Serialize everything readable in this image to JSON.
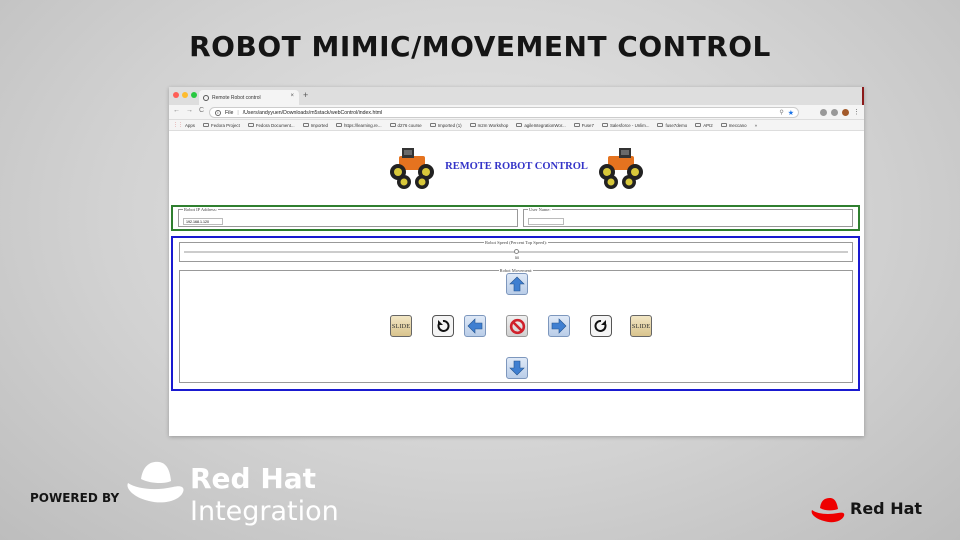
{
  "slide": {
    "title": "ROBOT MIMIC/MOVEMENT CONTROL",
    "powered_by": "POWERED BY",
    "integration_logo_line1": "Red Hat",
    "integration_logo_line2": "Integration",
    "redhat_logo": "Red Hat"
  },
  "browser": {
    "tab_title": "Remote Robot control",
    "tab_close": "×",
    "new_tab": "+",
    "url_prefix": "File",
    "url": "/Users/andyyuen/Downloads/m5stack/webControl/index.html",
    "bookmarks": [
      "Apps",
      "Fedora Project",
      "Fedora Document...",
      "Imported",
      "https://learning.re...",
      "d276 course",
      "Imported (1)",
      "m2m Workshop",
      "agileIntegrationWor...",
      "Fuse7",
      "Salesforce - Unlim...",
      "fuse7demo",
      "API2",
      "meccano"
    ],
    "bookmarks_more": "»"
  },
  "page": {
    "heading": "REMOTE ROBOT CONTROL",
    "ip_legend": "Robot IP Address:",
    "ip_value": "192.168.1.120",
    "user_legend": "User Name:",
    "user_value": "",
    "speed_legend": "Robot Speed (Percent Top Speed):",
    "speed_value": "50",
    "speed_fraction": 0.5,
    "movement_legend": "Robot Movement:",
    "slide_left_label": "SLIDE",
    "slide_right_label": "SLIDE"
  },
  "colors": {
    "green_border": "#2f7f2f",
    "blue_border": "#1a1ad0",
    "heading": "#3434c8",
    "arrow": "#3f7fd1",
    "stop": "#d0202a",
    "redhat_red": "#ee0000"
  },
  "icons": {
    "up": "arrow-up-icon",
    "down": "arrow-down-icon",
    "left": "arrow-left-icon",
    "right": "arrow-right-icon",
    "rotate_left": "rotate-ccw-icon",
    "rotate_right": "rotate-cw-icon",
    "stop": "stop-icon"
  }
}
